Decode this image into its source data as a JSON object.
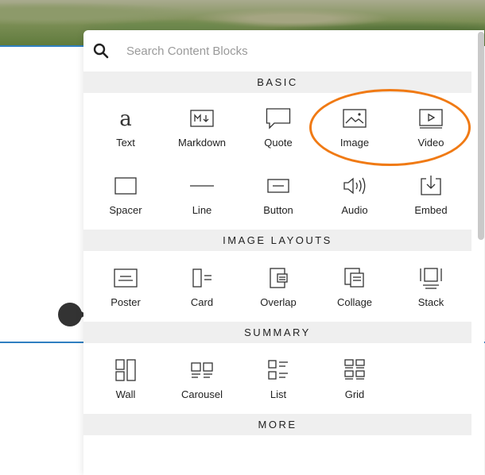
{
  "search": {
    "placeholder": "Search Content Blocks"
  },
  "sections": {
    "basic": {
      "title": "BASIC",
      "items": [
        {
          "label": "Text",
          "icon": "text-icon"
        },
        {
          "label": "Markdown",
          "icon": "markdown-icon"
        },
        {
          "label": "Quote",
          "icon": "quote-icon"
        },
        {
          "label": "Image",
          "icon": "image-icon"
        },
        {
          "label": "Video",
          "icon": "video-icon"
        },
        {
          "label": "Spacer",
          "icon": "spacer-icon"
        },
        {
          "label": "Line",
          "icon": "line-icon"
        },
        {
          "label": "Button",
          "icon": "button-icon"
        },
        {
          "label": "Audio",
          "icon": "audio-icon"
        },
        {
          "label": "Embed",
          "icon": "embed-icon"
        }
      ]
    },
    "image_layouts": {
      "title": "IMAGE LAYOUTS",
      "items": [
        {
          "label": "Poster",
          "icon": "poster-icon"
        },
        {
          "label": "Card",
          "icon": "card-icon"
        },
        {
          "label": "Overlap",
          "icon": "overlap-icon"
        },
        {
          "label": "Collage",
          "icon": "collage-icon"
        },
        {
          "label": "Stack",
          "icon": "stack-icon"
        }
      ]
    },
    "summary": {
      "title": "SUMMARY",
      "items": [
        {
          "label": "Wall",
          "icon": "wall-icon"
        },
        {
          "label": "Carousel",
          "icon": "carousel-icon"
        },
        {
          "label": "List",
          "icon": "list-icon"
        },
        {
          "label": "Grid",
          "icon": "grid-icon"
        }
      ]
    },
    "more": {
      "title": "MORE"
    }
  },
  "colors": {
    "highlight": "#f07a14",
    "accent_line": "#2f7fc1",
    "section_bg": "#efefef"
  }
}
